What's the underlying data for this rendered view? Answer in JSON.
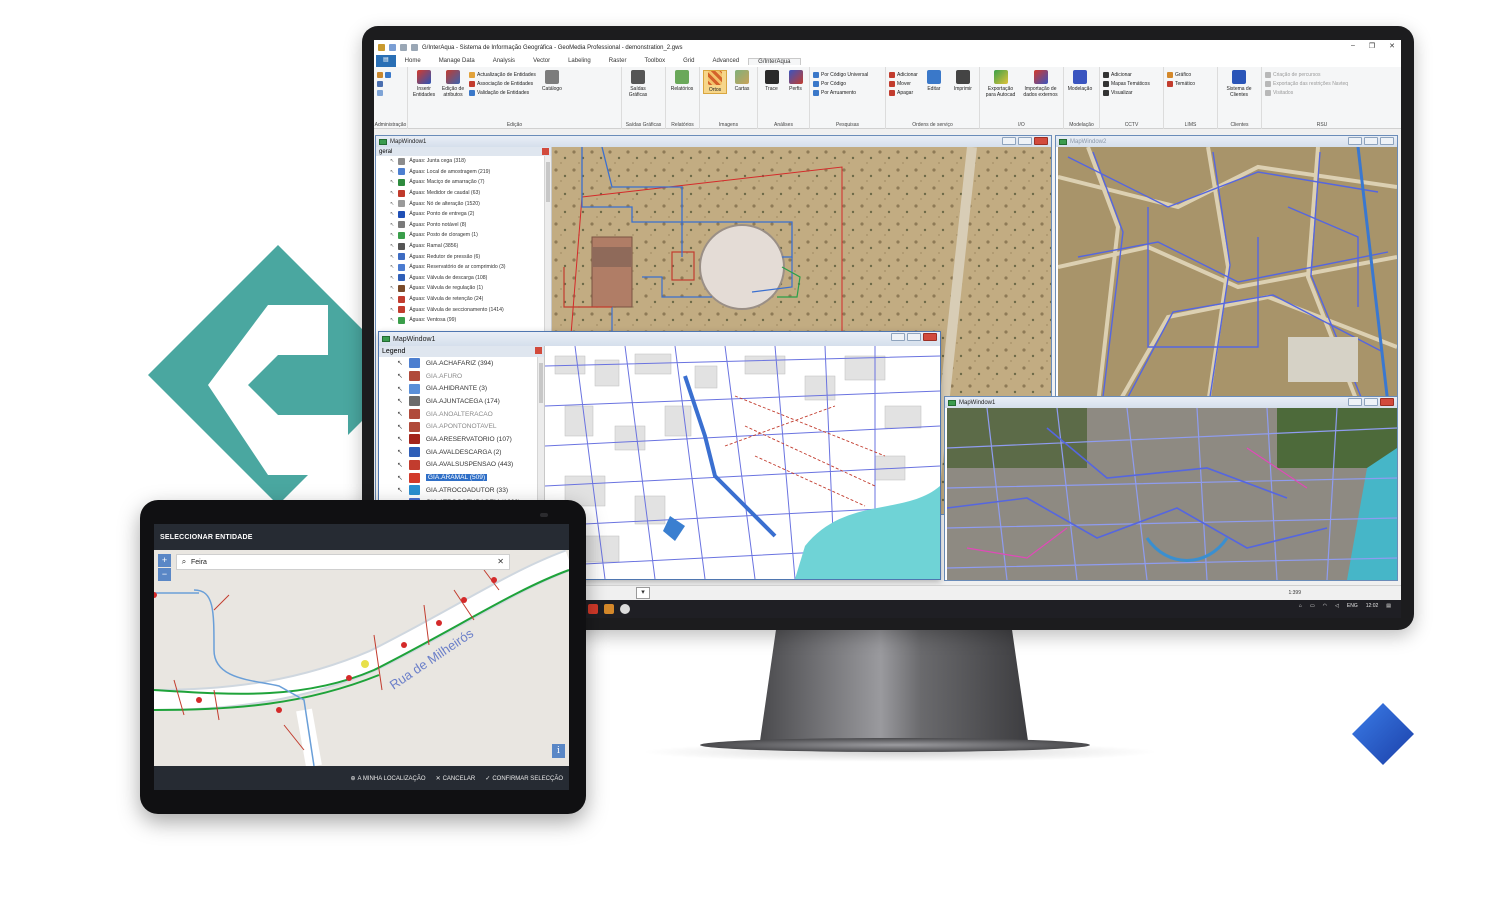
{
  "app": {
    "window_title": "G/InterAqua - Sistema de Informação Geográfica - GeoMedia Professional - demonstration_2.gws",
    "ribbon_tabs": [
      "Home",
      "Manage Data",
      "Analysis",
      "Vector",
      "Labeling",
      "Raster",
      "Toolbox",
      "Grid",
      "Advanced",
      "G/InterAqua"
    ],
    "active_tab": "G/InterAqua",
    "ribbon": {
      "administracao": {
        "label": "Administração"
      },
      "edicao": {
        "label": "Edição",
        "inserir": "Inserir Entidades",
        "edicao_atributos": "Edição de atributos",
        "small": [
          "Actualização de Entidades",
          "Associação de Entidades",
          "Validação de Entidades"
        ],
        "catalogo": "Catálogo"
      },
      "saidas": {
        "label": "Saídas Gráficas",
        "btn": "Saídas Gráficas"
      },
      "relatorios": {
        "label": "Relatórios",
        "btn": "Relatórios"
      },
      "imagens": {
        "label": "Imagens",
        "ortos": "Ortos",
        "cartas": "Cartas"
      },
      "analises": {
        "label": "Análises",
        "trace": "Trace",
        "perfis": "Perfis"
      },
      "pesquisas": {
        "label": "Pesquisas",
        "small": [
          "Por Código Universal",
          "Por Código",
          "Por Arruamento"
        ]
      },
      "ordens": {
        "label": "Ordens de serviço",
        "small": [
          "Adicionar",
          "Mover",
          "Apagar"
        ],
        "editar": "Editar",
        "imprimir": "Imprimir"
      },
      "io": {
        "label": "I/O",
        "export": "Exportação para Autocad",
        "import": "Importação de dados externos"
      },
      "modelacao": {
        "label": "Modelação",
        "btn": "Modelação"
      },
      "cctv": {
        "label": "CCTV",
        "small": [
          "Adicionar",
          "Mapas Temáticos",
          "Visualizar"
        ]
      },
      "lims": {
        "label": "LIMS",
        "small": [
          "Gráfico",
          "Temático"
        ]
      },
      "clientes": {
        "label": "Clientes",
        "btn": "Sistema de Clientes"
      },
      "rsu": {
        "label": "RSU",
        "small": [
          "Criação de percursos",
          "Exportação das restrições Navteq",
          "Visitados"
        ]
      }
    }
  },
  "windows": {
    "mw_top_left": {
      "title": "MapWindow1",
      "legend_title": "geral"
    },
    "mw_top_right": {
      "title": "MapWindow2"
    },
    "mw_front": {
      "title": "MapWindow1",
      "legend_title": "Legend"
    },
    "mw_bottom_right": {
      "title": "MapWindow1"
    }
  },
  "legend_small": [
    {
      "label": "Águas: Junta cega (318)",
      "color": "#8c8c8c"
    },
    {
      "label": "Águas: Local de amostragem (219)",
      "color": "#4d7fd0"
    },
    {
      "label": "Águas: Maciço de amarração (7)",
      "color": "#2e8b3e"
    },
    {
      "label": "Águas: Medidor de caudal (63)",
      "color": "#c03a2b"
    },
    {
      "label": "Águas: Nó de alteração (1520)",
      "color": "#9a9a9a"
    },
    {
      "label": "Águas: Ponto de entrega (2)",
      "color": "#1f4fb5"
    },
    {
      "label": "Águas: Ponto notável (8)",
      "color": "#7a7a7a"
    },
    {
      "label": "Águas: Posto de cloragem (1)",
      "color": "#3a9e4a"
    },
    {
      "label": "Águas: Ramal (3856)",
      "color": "#555555"
    },
    {
      "label": "Águas: Redutor de pressão (6)",
      "color": "#3d6bc2"
    },
    {
      "label": "Águas: Reservatório de ar comprimido (3)",
      "color": "#4b7bd0"
    },
    {
      "label": "Águas: Válvula de descarga (108)",
      "color": "#2f5fb8"
    },
    {
      "label": "Águas: Válvula de regulação (1)",
      "color": "#7a4b2a"
    },
    {
      "label": "Águas: Válvula de retenção (24)",
      "color": "#c23c2e"
    },
    {
      "label": "Águas: Válvula de seccionamento (1414)",
      "color": "#c23c2e"
    },
    {
      "label": "Águas: Ventosa (99)",
      "color": "#3a9e4a"
    }
  ],
  "legend_front": [
    {
      "label": "GIA.ACHAFARIZ (394)",
      "color": "#4d7fd0",
      "state": "normal"
    },
    {
      "label": "GIA.AFURO",
      "color": "#b04a3a",
      "state": "dim"
    },
    {
      "label": "GIA.AHIDRANTE (3)",
      "color": "#5a8fd8",
      "state": "normal"
    },
    {
      "label": "GIA.AJUNTACEGA (174)",
      "color": "#6b6b6b",
      "state": "normal"
    },
    {
      "label": "GIA.ANOALTERACAO",
      "color": "#b04a3a",
      "state": "dim"
    },
    {
      "label": "GIA.APONTONOTAVEL",
      "color": "#b04a3a",
      "state": "dim"
    },
    {
      "label": "GIA.ARESERVATORIO (107)",
      "color": "#a3241b",
      "state": "normal"
    },
    {
      "label": "GIA.AVALDESCARGA (2)",
      "color": "#2f5fb8",
      "state": "normal"
    },
    {
      "label": "GIA.AVALSUSPENSAO (443)",
      "color": "#c23c2e",
      "state": "normal"
    },
    {
      "label": "GIA.ARAMAL (509)",
      "color": "#d23a2b",
      "state": "selected"
    },
    {
      "label": "GIA.ATROCOADUTOR (33)",
      "color": "#2b8fd0",
      "state": "normal"
    },
    {
      "label": "GIA.ATROCOTUBAGEM (1666)",
      "color": "#4a6fd0",
      "state": "normal"
    }
  ],
  "status": {
    "scale": "1:399"
  },
  "taskbar": {
    "lang": "ENG",
    "time": "12:02"
  },
  "tablet": {
    "header": "SELECCIONAR ENTIDADE",
    "search_value": "Feira",
    "street_label": "Rua de Milheirós",
    "zoom_in": "+",
    "zoom_out": "−",
    "info": "i",
    "actions": {
      "locate": "A MINHA LOCALIZAÇÃO",
      "cancel": "CANCELAR",
      "confirm": "CONFIRMAR SELECÇÃO"
    }
  },
  "colors": {
    "teal": "#4aa7a0",
    "accent_blue": "#2a6fb5",
    "pipe_blue": "#4b5fd6",
    "pipe_green": "#1fa33a"
  }
}
